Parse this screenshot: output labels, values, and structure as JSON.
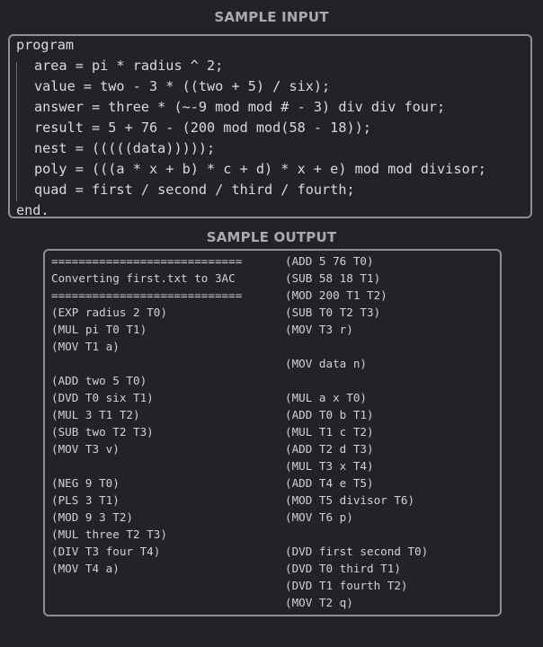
{
  "sample_input": {
    "heading": "SAMPLE INPUT",
    "lines": [
      "program",
      "area = pi * radius ^ 2;",
      "value = two - 3 * ((two + 5) / six);",
      "answer = three * (~-9 mod mod # - 3) div div four;",
      "result = 5 + 76 - (200 mod mod(58 - 18));",
      "nest = (((((data)))));",
      "poly = (((a * x + b) * c + d) * x + e) mod mod divisor;",
      "quad = first / second / third / fourth;",
      "end."
    ]
  },
  "sample_output": {
    "heading": "SAMPLE OUTPUT",
    "left_column": [
      "============================",
      "Converting first.txt to 3AC",
      "============================",
      "(EXP radius 2 T0)",
      "(MUL pi T0 T1)",
      "(MOV T1 a)",
      "",
      "(ADD two 5 T0)",
      "(DVD T0 six T1)",
      "(MUL 3 T1 T2)",
      "(SUB two T2 T3)",
      "(MOV T3 v)",
      "",
      "(NEG 9 T0)",
      "(PLS 3 T1)",
      "(MOD 9 3 T2)",
      "(MUL three T2 T3)",
      "(DIV T3 four T4)",
      "(MOV T4 a)"
    ],
    "right_column": [
      "(ADD 5 76 T0)",
      "(SUB 58 18 T1)",
      "(MOD 200 T1 T2)",
      "(SUB T0 T2 T3)",
      "(MOV T3 r)",
      "",
      "(MOV data n)",
      "",
      "(MUL a x T0)",
      "(ADD T0 b T1)",
      "(MUL T1 c T2)",
      "(ADD T2 d T3)",
      "(MUL T3 x T4)",
      "(ADD T4 e T5)",
      "(MOD T5 divisor T6)",
      "(MOV T6 p)",
      "",
      "(DVD first second T0)",
      "(DVD T0 third T1)",
      "(DVD T1 fourth T2)",
      "(MOV T2 q)"
    ]
  }
}
